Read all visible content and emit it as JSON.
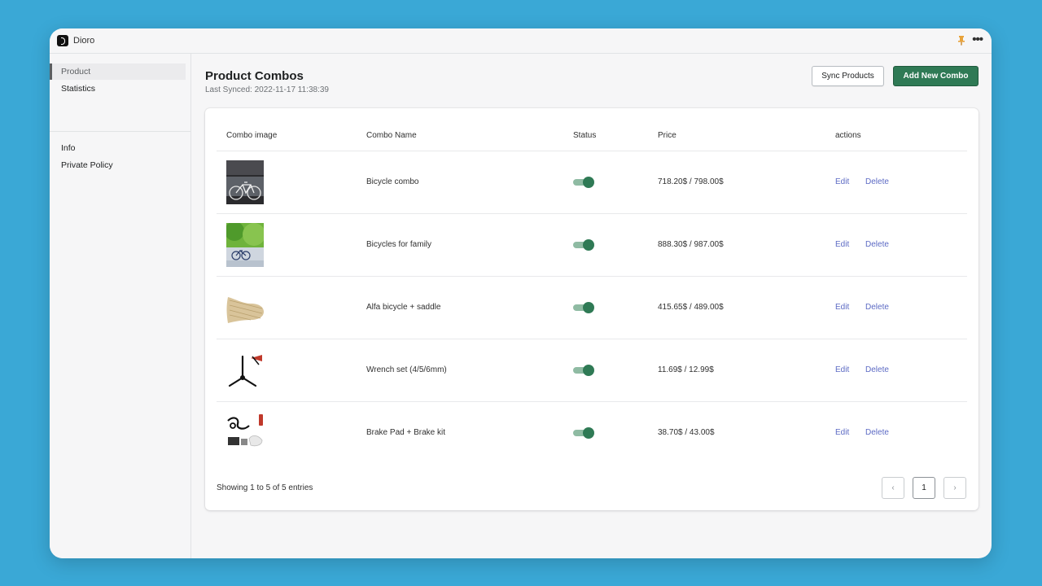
{
  "app": {
    "name": "Dioro"
  },
  "sidebar": {
    "items": [
      {
        "label": "Product",
        "active": true
      },
      {
        "label": "Statistics",
        "active": false
      },
      {
        "label": "Info",
        "active": false
      },
      {
        "label": "Private Policy",
        "active": false
      }
    ]
  },
  "header": {
    "title": "Product Combos",
    "last_synced": "Last Synced: 2022-11-17 11:38:39",
    "sync_label": "Sync Products",
    "add_label": "Add New Combo"
  },
  "table": {
    "columns": [
      "Combo image",
      "Combo Name",
      "Status",
      "Price",
      "actions"
    ],
    "edit_label": "Edit",
    "delete_label": "Delete",
    "rows": [
      {
        "name": "Bicycle combo",
        "price": "718.20$ / 798.00$",
        "status_on": true,
        "image": "bicycle-photo"
      },
      {
        "name": "Bicycles for family",
        "price": "888.30$ / 987.00$",
        "status_on": true,
        "image": "family-bicycles-photo"
      },
      {
        "name": "Alfa bicycle + saddle",
        "price": "415.65$ / 489.00$",
        "status_on": true,
        "image": "saddle-photo"
      },
      {
        "name": "Wrench set (4/5/6mm)",
        "price": "11.69$ / 12.99$",
        "status_on": true,
        "image": "wrench-set-photo"
      },
      {
        "name": "Brake Pad + Brake kit",
        "price": "38.70$ / 43.00$",
        "status_on": true,
        "image": "brake-kit-photo"
      }
    ]
  },
  "footer": {
    "showing": "Showing 1 to 5 of 5 entries",
    "current_page": "1"
  },
  "colors": {
    "background": "#3aa8d6",
    "primary": "#2f7a55",
    "link": "#5c6ac4"
  }
}
